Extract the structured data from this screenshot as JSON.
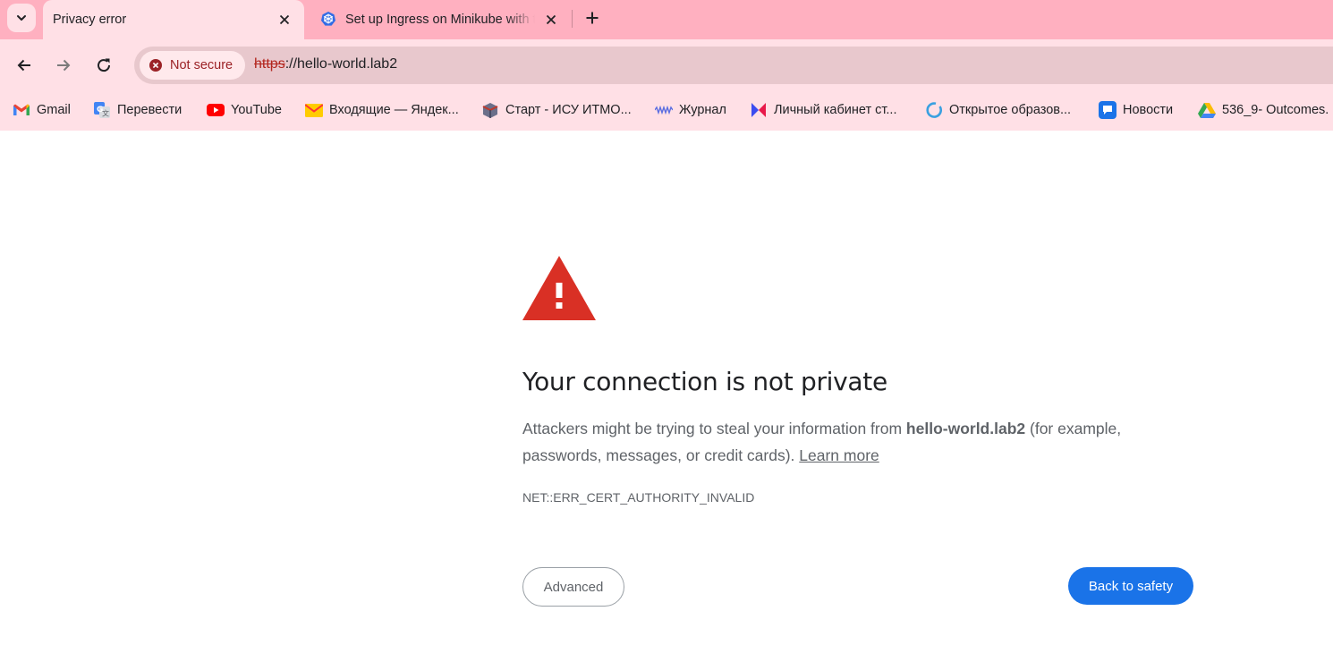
{
  "tabs": [
    {
      "title": "Privacy error",
      "active": true
    },
    {
      "title": "Set up Ingress on Minikube with the NGINX Ingress Controller",
      "active": false
    }
  ],
  "omnibox": {
    "security_chip": "Not secure",
    "url_scheme": "https",
    "url_rest": "://hello-world.lab2"
  },
  "bookmarks": [
    {
      "label": "Gmail",
      "icon": "gmail-icon"
    },
    {
      "label": "Перевести",
      "icon": "translate-icon"
    },
    {
      "label": "YouTube",
      "icon": "youtube-icon"
    },
    {
      "label": "Входящие — Яндек...",
      "icon": "yandex-mail-icon"
    },
    {
      "label": "Старт - ИСУ ИТМО...",
      "icon": "isu-icon"
    },
    {
      "label": "Журнал",
      "icon": "journal-icon"
    },
    {
      "label": "Личный кабинет ст...",
      "icon": "cabinet-icon"
    },
    {
      "label": "Открытое образов...",
      "icon": "openedu-icon"
    },
    {
      "label": "Новости",
      "icon": "news-icon"
    },
    {
      "label": "536_9- Outcomes.",
      "icon": "google-drive-icon"
    }
  ],
  "page": {
    "heading": "Your connection is not private",
    "desc_before": "Attackers might be trying to steal your information from ",
    "desc_host": "hello-world.lab2",
    "desc_after": " (for example, passwords, messages, or credit cards). ",
    "learn_more": "Learn more",
    "error_code": "NET::ERR_CERT_AUTHORITY_INVALID",
    "advanced_label": "Advanced",
    "back_label": "Back to safety"
  },
  "colors": {
    "tabstrip": "#ffb0c0",
    "toolbar": "#ffe0e6",
    "warning_red": "#d93025",
    "primary_blue": "#1a73e8"
  }
}
